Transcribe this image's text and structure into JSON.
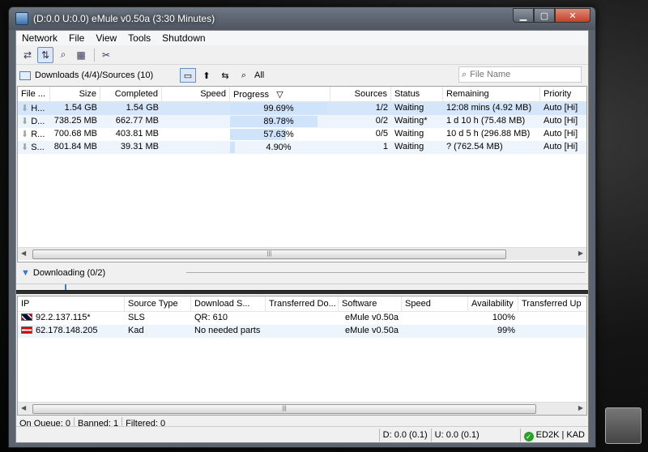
{
  "window": {
    "title": "(D:0.0 U:0.0) eMule v0.50a (3:30 Minutes)"
  },
  "menu": [
    "Network",
    "File",
    "View",
    "Tools",
    "Shutdown"
  ],
  "toolbar": {
    "icons": [
      "connect-icon",
      "transfer-icon",
      "search-icon",
      "shared-files-icon",
      "preferences-icon"
    ]
  },
  "downloads": {
    "header": "Downloads (4/4)/Sources (10)",
    "all_label": "All",
    "search_placeholder": "File Name",
    "columns": [
      "File ...",
      "Size",
      "Completed",
      "Speed",
      "Progress",
      "Sources",
      "Status",
      "Remaining",
      "Priority"
    ],
    "progress_sort_indicator": "▽",
    "rows": [
      {
        "name": "H...",
        "size": "1.54 GB",
        "completed": "1.54 GB",
        "speed": "",
        "progress": 99.69,
        "progress_label": "99.69%",
        "sources": "1/2",
        "status": "Waiting",
        "remaining": "12:08 mins (4.92 MB)",
        "priority": "Auto [Hi]"
      },
      {
        "name": "D...",
        "size": "738.25 MB",
        "completed": "662.77 MB",
        "speed": "",
        "progress": 89.78,
        "progress_label": "89.78%",
        "sources": "0/2",
        "status": "Waiting*",
        "remaining": "1 d 10 h (75.48 MB)",
        "priority": "Auto [Hi]"
      },
      {
        "name": "R...",
        "size": "700.68 MB",
        "completed": "403.81 MB",
        "speed": "",
        "progress": 57.63,
        "progress_label": "57.63%",
        "sources": "0/5",
        "status": "Waiting",
        "remaining": "10 d 5 h (296.88 MB)",
        "priority": "Auto [Hi]"
      },
      {
        "name": "S...",
        "size": "801.84 MB",
        "completed": "39.31 MB",
        "speed": "",
        "progress": 4.9,
        "progress_label": "4.90%",
        "sources": "1",
        "status": "Waiting",
        "remaining": "? (762.54 MB)",
        "priority": "Auto [Hi]"
      }
    ]
  },
  "downloading": {
    "header": "Downloading (0/2)"
  },
  "sources": {
    "columns": [
      "IP",
      "Source Type",
      "Download S...",
      "Transferred Do...",
      "Software",
      "Speed",
      "Availability",
      "Transferred Up"
    ],
    "rows": [
      {
        "flag": "uk",
        "ip": "92.2.137.115*",
        "type": "SLS",
        "download_status": "QR: 610",
        "transferred_down": "",
        "software": "eMule v0.50a",
        "speed": "",
        "availability": "100%",
        "transferred_up": ""
      },
      {
        "flag": "at",
        "ip": "62.178.148.205",
        "type": "Kad",
        "download_status": "No needed parts",
        "transferred_down": "",
        "software": "eMule v0.50a",
        "speed": "",
        "availability": "99%",
        "transferred_up": ""
      }
    ]
  },
  "status_left": {
    "queue": "On Queue: 0",
    "banned": "Banned: 1",
    "filtered": "Filtered: 0"
  },
  "status_bottom": {
    "down": "D: 0.0 (0.1)",
    "up": "U: 0.0 (0.1)",
    "network": "ED2K | KAD"
  }
}
